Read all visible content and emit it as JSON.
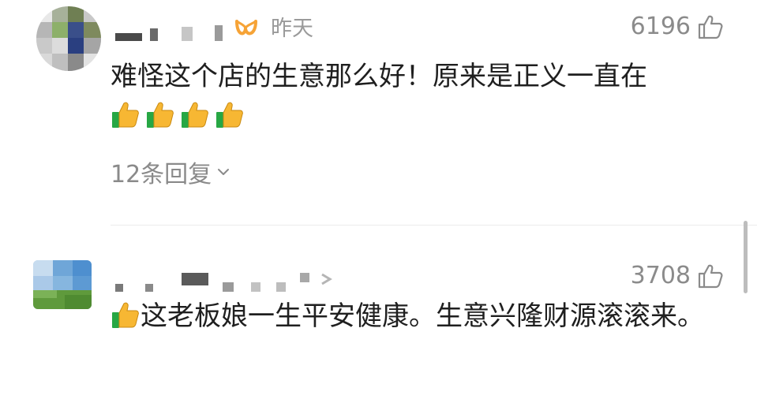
{
  "comments": [
    {
      "username_visible": "",
      "time": "昨天",
      "likes": "6196",
      "text": "难怪这个店的生意那么好！原来是正义一直在",
      "emoji_count": 4,
      "replies_label": "12条回复"
    },
    {
      "username_visible": "",
      "likes": "3708",
      "text": "这老板娘一生平安健康。生意兴隆财源滚滚来。"
    }
  ],
  "icons": {
    "like": "thumbs-up-outline-icon",
    "emoji": "thumbs-up-emoji",
    "vip": "vip-badge-icon",
    "expand": "chevron-down-icon"
  },
  "colors": {
    "text": "#1f1f1f",
    "meta": "#8a8a8a",
    "vip_orange": "#f6a336",
    "emoji_yellow": "#f7b733",
    "emoji_green": "#27a744"
  }
}
